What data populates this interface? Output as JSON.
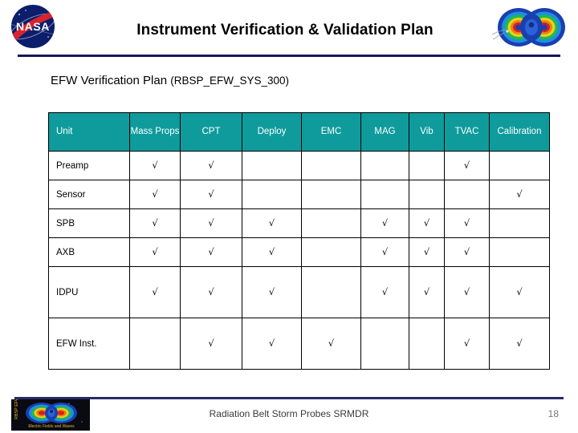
{
  "header": {
    "title": "Instrument Verification & Validation Plan",
    "nasa_logo_alt": "NASA",
    "belt_graphic_alt": "Radiation belt magnetosphere visualization",
    "rule_color": "#151560"
  },
  "subtitle": {
    "main": "EFW Verification Plan ",
    "paren": "(RBSP_EFW_SYS_300)"
  },
  "table": {
    "header_bg": "#0f9b9b",
    "header_text_color": "#ffffff",
    "check_glyph": "√",
    "columns": [
      "Unit",
      "Mass Props",
      "CPT",
      "Deploy",
      "EMC",
      "MAG",
      "Vib",
      "TVAC",
      "Calibration"
    ],
    "rows": [
      {
        "unit": "Preamp",
        "mass_props": "√",
        "cpt": "√",
        "deploy": "",
        "emc": "",
        "mag": "",
        "vib": "",
        "tvac": "√",
        "calibration": ""
      },
      {
        "unit": "Sensor",
        "mass_props": "√",
        "cpt": "√",
        "deploy": "",
        "emc": "",
        "mag": "",
        "vib": "",
        "tvac": "",
        "calibration": "√"
      },
      {
        "unit": "SPB",
        "mass_props": "√",
        "cpt": "√",
        "deploy": "√",
        "emc": "",
        "mag": "√",
        "vib": "√",
        "tvac": "√",
        "calibration": ""
      },
      {
        "unit": "AXB",
        "mass_props": "√",
        "cpt": "√",
        "deploy": "√",
        "emc": "",
        "mag": "√",
        "vib": "√",
        "tvac": "√",
        "calibration": ""
      },
      {
        "unit": "IDPU",
        "mass_props": "√",
        "cpt": "√",
        "deploy": "√",
        "emc": "",
        "mag": "√",
        "vib": "√",
        "tvac": "√",
        "calibration": "√"
      },
      {
        "unit": "EFW Inst.",
        "mass_props": "",
        "cpt": "√",
        "deploy": "√",
        "emc": "√",
        "mag": "",
        "vib": "",
        "tvac": "√",
        "calibration": "√"
      }
    ]
  },
  "footer": {
    "center_text": "Radiation Belt Storm Probes SRMDR",
    "page_number": "18",
    "logo_side_text": "RBSP EFW",
    "logo_bottom_text": "Electric Fields and Waves",
    "rule_color": "#2a2a66"
  }
}
